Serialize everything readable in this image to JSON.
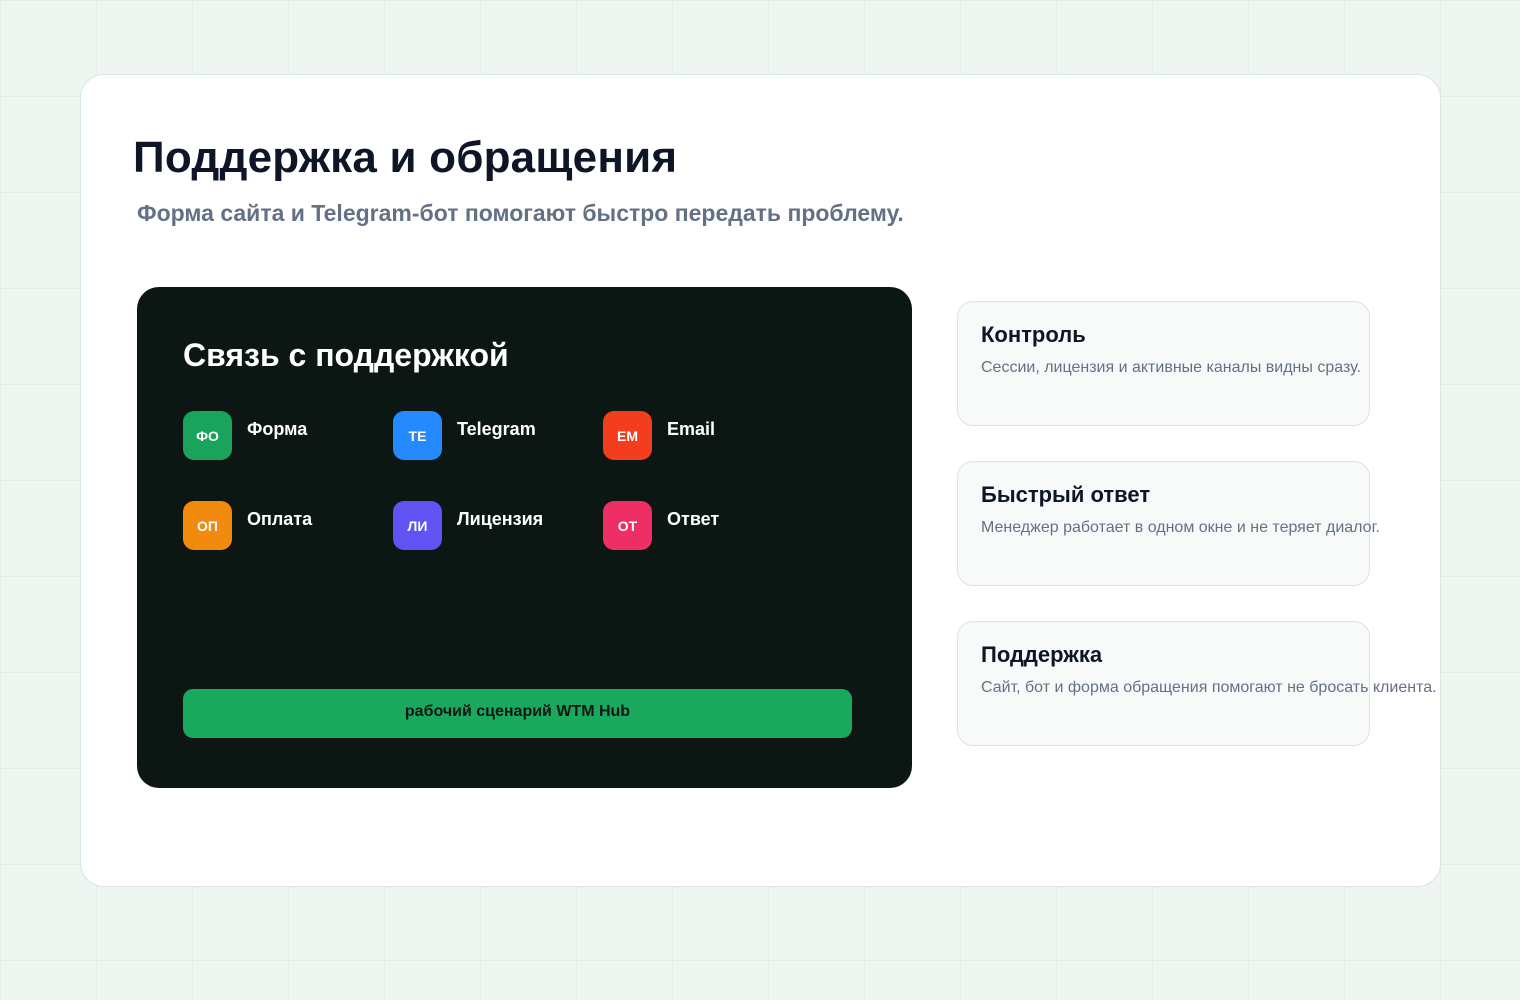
{
  "header": {
    "title": "Поддержка и обращения",
    "subtitle": "Форма сайта и Telegram-бот помогают быстро передать проблему."
  },
  "support_panel": {
    "title": "Связь с поддержкой",
    "channels": [
      {
        "badge": "ФО",
        "label": "Форма",
        "color": "#1aa35c"
      },
      {
        "badge": "TE",
        "label": "Telegram",
        "color": "#2589ff"
      },
      {
        "badge": "EM",
        "label": "Email",
        "color": "#f23d1e"
      },
      {
        "badge": "ОП",
        "label": "Оплата",
        "color": "#f28a10"
      },
      {
        "badge": "ЛИ",
        "label": "Лицензия",
        "color": "#6152f4"
      },
      {
        "badge": "ОТ",
        "label": "Ответ",
        "color": "#ee2f66"
      }
    ],
    "cta_label": "рабочий сценарий WTM Hub",
    "cta_color": "#19a85c"
  },
  "features": [
    {
      "title": "Контроль",
      "description": "Сессии, лицензия и активные каналы видны сразу."
    },
    {
      "title": "Быстрый ответ",
      "description": "Менеджер работает в одном окне и не теряет диалог."
    },
    {
      "title": "Поддержка",
      "description": "Сайт, бот и форма обращения помогают не бросать клиента."
    }
  ]
}
